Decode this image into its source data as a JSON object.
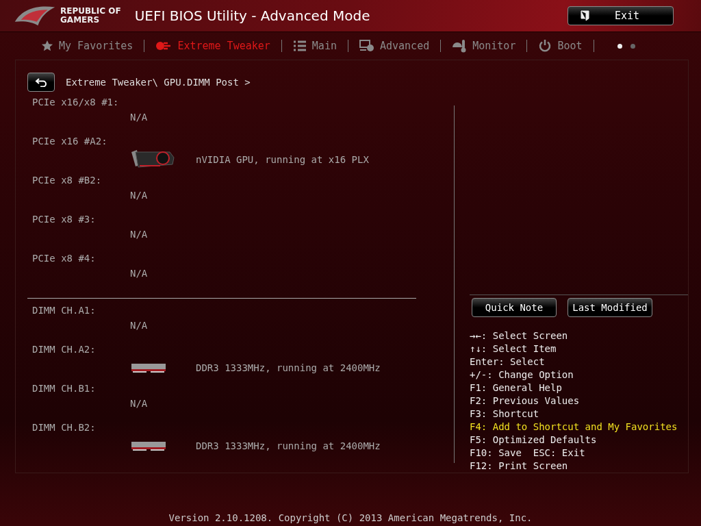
{
  "header": {
    "brand_line_1": "REPUBLIC OF",
    "brand_line_2": "GAMERS",
    "title": "UEFI BIOS Utility - Advanced Mode",
    "exit_button": "Exit"
  },
  "tabs": [
    {
      "label": "My Favorites",
      "kind": "star",
      "selected": false
    },
    {
      "label": "Extreme Tweaker",
      "kind": "tweaker",
      "selected": true
    },
    {
      "label": "Main",
      "kind": "list",
      "selected": false
    },
    {
      "label": "Advanced",
      "kind": "advanced",
      "selected": false
    },
    {
      "label": "Monitor",
      "kind": "monitor",
      "selected": false
    },
    {
      "label": "Boot",
      "kind": "power",
      "selected": false
    }
  ],
  "page_dots": [
    {
      "selected": true
    },
    {
      "selected": false
    }
  ],
  "breadcrumb": "Extreme Tweaker\\ GPU.DIMM Post >",
  "groups": [
    {
      "slots": [
        {
          "label": "PCIe x16/x8 #1:",
          "kind": "none",
          "value": "N/A"
        },
        {
          "label": "PCIe x16 #A2:",
          "kind": "gpu",
          "value": "nVIDIA GPU, running at x16 PLX"
        },
        {
          "label": "PCIe x8 #B2:",
          "kind": "none",
          "value": "N/A"
        },
        {
          "label": "PCIe x8 #3:",
          "kind": "none",
          "value": "N/A"
        },
        {
          "label": "PCIe x8 #4:",
          "kind": "none",
          "value": "N/A"
        }
      ]
    },
    {
      "slots": [
        {
          "label": "DIMM CH.A1:",
          "kind": "none",
          "value": "N/A"
        },
        {
          "label": "DIMM CH.A2:",
          "kind": "dimm",
          "value": "DDR3 1333MHz, running at 2400MHz"
        },
        {
          "label": "DIMM CH.B1:",
          "kind": "none",
          "value": "N/A"
        },
        {
          "label": "DIMM CH.B2:",
          "kind": "dimm",
          "value": "DDR3 1333MHz, running at 2400MHz"
        }
      ]
    }
  ],
  "side_buttons": [
    "Quick Note",
    "Last Modified"
  ],
  "help": [
    {
      "text": "→←: Select Screen",
      "highlight": false
    },
    {
      "text": "↑↓: Select Item",
      "highlight": false
    },
    {
      "text": "Enter: Select",
      "highlight": false
    },
    {
      "text": "+/-: Change Option",
      "highlight": false
    },
    {
      "text": "F1: General Help",
      "highlight": false
    },
    {
      "text": "F2: Previous Values",
      "highlight": false
    },
    {
      "text": "F3: Shortcut",
      "highlight": false
    },
    {
      "text": "F4: Add to Shortcut and My Favorites",
      "highlight": true
    },
    {
      "text": "F5: Optimized Defaults",
      "highlight": false
    },
    {
      "text": "F10: Save  ESC: Exit",
      "highlight": false
    },
    {
      "text": "F12: Print Screen",
      "highlight": false
    }
  ],
  "footer": "Version 2.10.1208. Copyright (C) 2013 American Megatrends, Inc."
}
